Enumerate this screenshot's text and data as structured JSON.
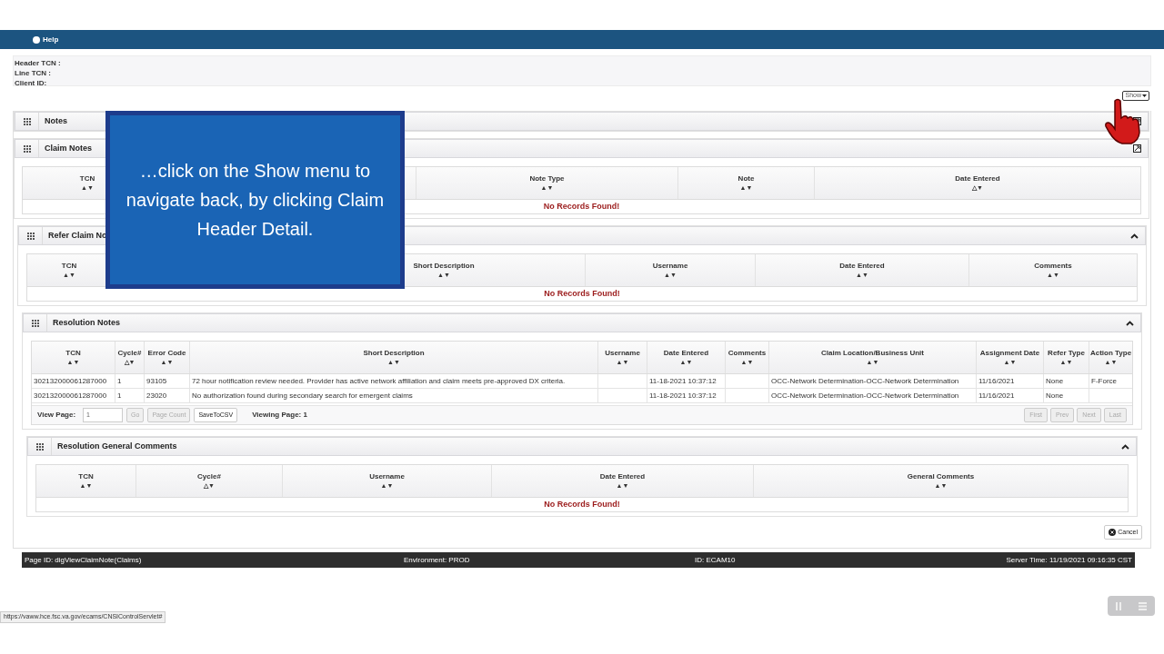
{
  "nav": {
    "help": "Help"
  },
  "claim_info": [
    "Header TCN :",
    "Line TCN :",
    "Client ID:"
  ],
  "show_menu": {
    "label": "Show"
  },
  "panels": [
    {
      "kind": "bar",
      "title": "Notes"
    },
    {
      "kind": "table",
      "title": "Claim Notes",
      "columns": [
        {
          "label": "TCN",
          "sort": "▲▼"
        },
        {
          "label": "Note Type",
          "sort": "▲▼"
        },
        {
          "label": "Note",
          "sort": "▲▼"
        },
        {
          "label": "Date Entered",
          "sort": "△▼"
        }
      ],
      "empty_message": "No Records Found!"
    },
    {
      "kind": "table",
      "title": "Refer Claim No",
      "expanded": true,
      "columns": [
        {
          "label": "TCN",
          "sort": "▲▼"
        },
        {
          "label": "Short Description",
          "sort": "▲▼"
        },
        {
          "label": "Username",
          "sort": "▲▼"
        },
        {
          "label": "Date Entered",
          "sort": "▲▼"
        },
        {
          "label": "Comments",
          "sort": "▲▼"
        }
      ],
      "empty_message": "No Records Found!"
    },
    {
      "kind": "table",
      "title": "Resolution Notes",
      "expanded": true,
      "columns": [
        {
          "label": "TCN",
          "sort": "▲▼"
        },
        {
          "label": "Cycle#",
          "sort": "△▼"
        },
        {
          "label": "Error Code",
          "sort": "▲▼"
        },
        {
          "label": "Short Description",
          "sort": "▲▼"
        },
        {
          "label": "Username",
          "sort": "▲▼"
        },
        {
          "label": "Date Entered",
          "sort": "▲▼"
        },
        {
          "label": "Comments",
          "sort": "▲▼"
        },
        {
          "label": "Claim Location/Business Unit",
          "sort": "▲▼"
        },
        {
          "label": "Assignment Date",
          "sort": "▲▼"
        },
        {
          "label": "Refer Type",
          "sort": "▲▼"
        },
        {
          "label": "Action Type",
          "sort": "▲▼"
        }
      ],
      "rows": [
        [
          "302132000061287000",
          "1",
          "93105",
          "72 hour notification review needed. Provider has active network affiliation and claim meets pre-approved DX criteria.",
          null,
          "11-18-2021 10:37:12",
          null,
          "OCC-Network Determination-OCC-Network Determination",
          "11/16/2021",
          "None",
          "F-Force"
        ],
        [
          "302132000061287000",
          "1",
          "23020",
          "No authorization found during secondary search for emergent claims",
          null,
          "11-18-2021 10:37:12",
          null,
          "OCC-Network Determination-OCC-Network Determination",
          "11/16/2021",
          "None",
          null
        ]
      ],
      "pager": {
        "view_page_label": "View Page:",
        "page_value": "1",
        "tools": [
          {
            "label": "Go",
            "disabled": true
          },
          {
            "label": "Page Count",
            "disabled": true
          },
          {
            "label": "SaveToCSV",
            "disabled": false
          }
        ],
        "viewing": "Viewing Page: 1",
        "nav": [
          {
            "label": "First",
            "disabled": true
          },
          {
            "label": "Prev",
            "disabled": true
          },
          {
            "label": "Next",
            "disabled": true
          },
          {
            "label": "Last",
            "disabled": true
          }
        ]
      }
    },
    {
      "kind": "table",
      "title": "Resolution General Comments",
      "expanded": true,
      "columns": [
        {
          "label": "TCN",
          "sort": "▲▼"
        },
        {
          "label": "Cycle#",
          "sort": "△▼"
        },
        {
          "label": "Username",
          "sort": "▲▼"
        },
        {
          "label": "Date Entered",
          "sort": "▲▼"
        },
        {
          "label": "General Comments",
          "sort": "▲▼"
        }
      ],
      "empty_message": "No Records Found!"
    }
  ],
  "cancel_button": "Cancel",
  "footer": {
    "page_id": "Page ID: digViewClaimNote(Claims)",
    "environment": "Environment: PROD",
    "id": "ID: ECAM10",
    "server_time": "Server Time: 11/19/2021 09:16:35 CST"
  },
  "status_url": "https://vaww.hce.fsc.va.gov/ecams/CNSIControlServlet#",
  "callout": "…click on the Show menu to navigate back, by clicking Claim Header Detail."
}
